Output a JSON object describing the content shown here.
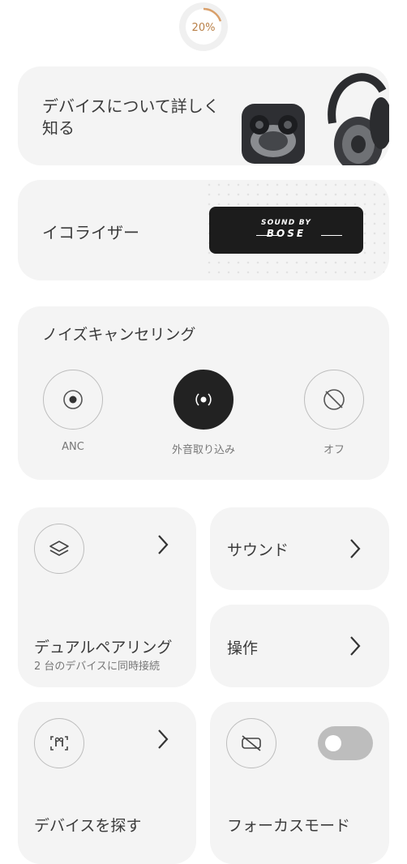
{
  "battery": {
    "percent_label": "20%",
    "level": 0.2
  },
  "learn": {
    "title": "デバイスについて詳しく知る"
  },
  "equalizer": {
    "title": "イコライザー",
    "logo_line1": "SOUND BY",
    "logo_line2": "BOSE"
  },
  "noise_cancelling": {
    "title": "ノイズキャンセリング",
    "modes": [
      {
        "label": "ANC",
        "icon": "anc-icon",
        "active": false
      },
      {
        "label": "外音取り込み",
        "icon": "aware-icon",
        "active": true
      },
      {
        "label": "オフ",
        "icon": "off-icon",
        "active": false
      }
    ]
  },
  "dual_pairing": {
    "title": "デュアルペアリング",
    "subtitle": "2 台のデバイスに同時接続",
    "icon": "layers-icon"
  },
  "sound": {
    "title": "サウンド"
  },
  "controls": {
    "title": "操作"
  },
  "find_device": {
    "title": "デバイスを探す",
    "icon": "earbuds-icon"
  },
  "focus_mode": {
    "title": "フォーカスモード",
    "icon": "focus-off-icon",
    "enabled": false
  },
  "colors": {
    "accent": "#d9a06b",
    "card": "#f4f4f4",
    "active": "#222222"
  }
}
